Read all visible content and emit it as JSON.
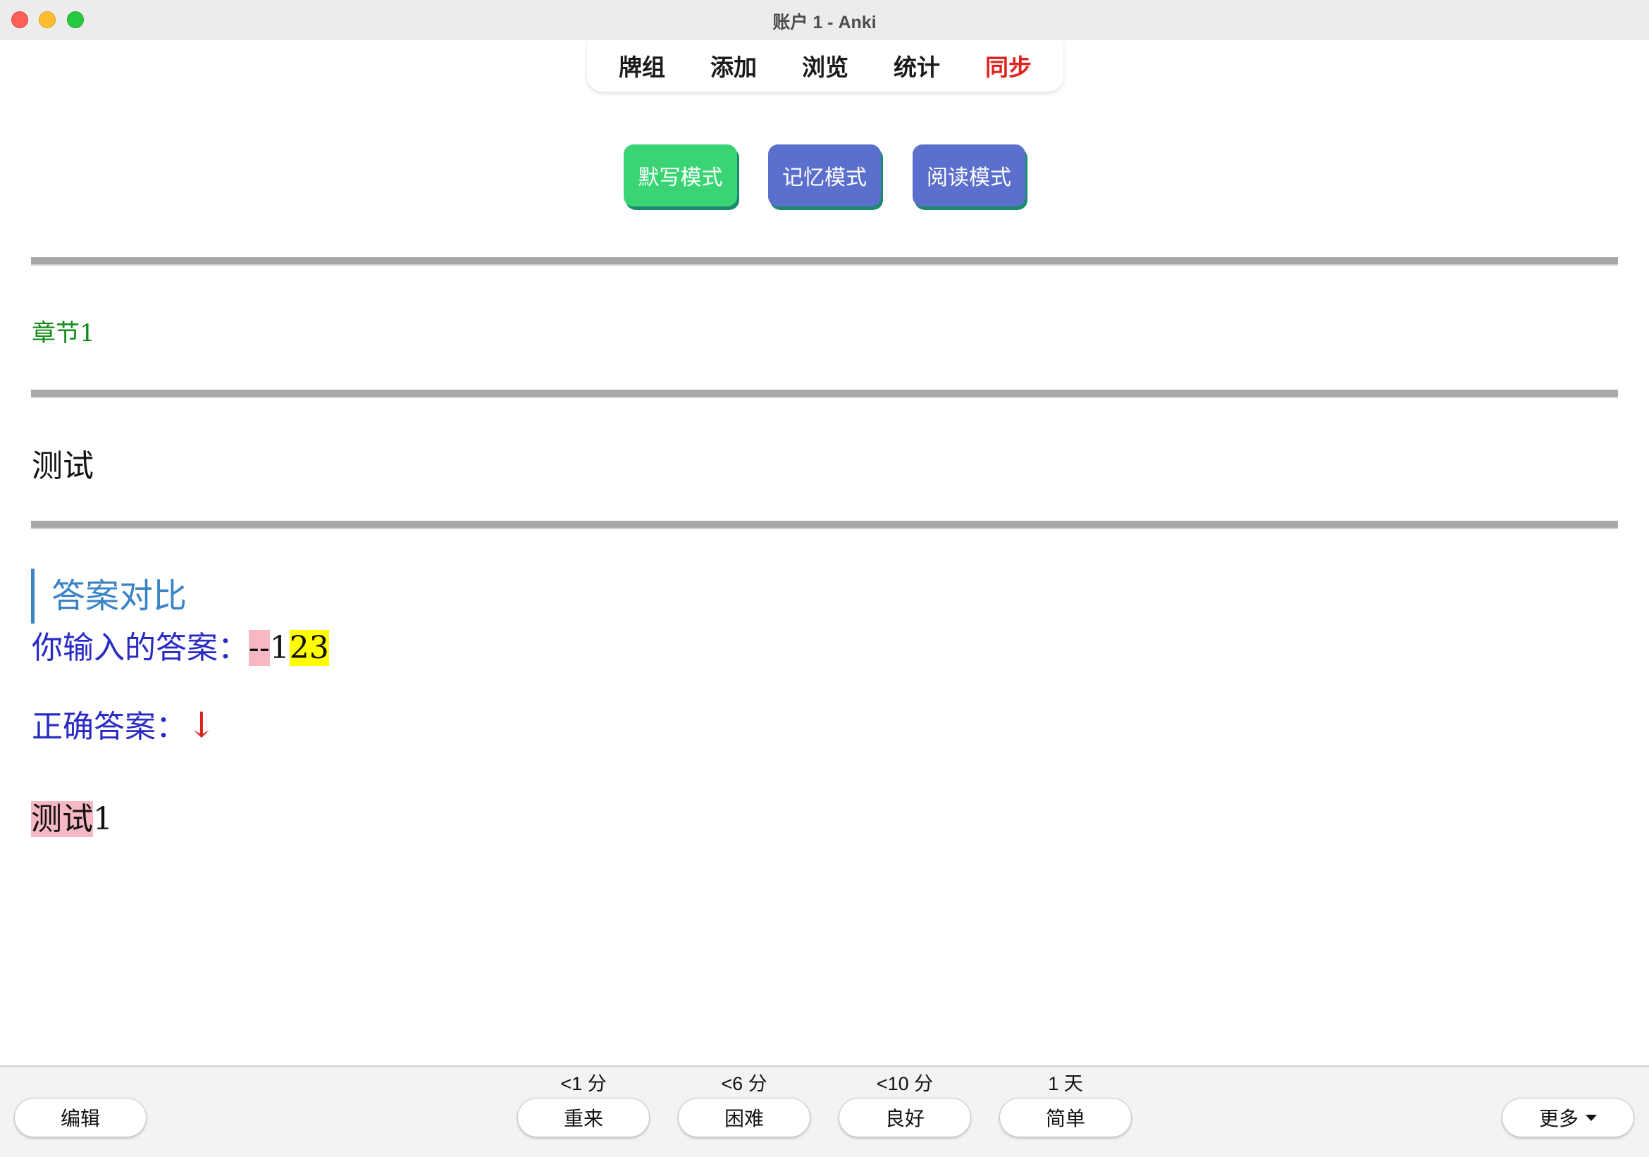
{
  "window": {
    "title": "账户 1 - Anki"
  },
  "nav": {
    "decks": "牌组",
    "add": "添加",
    "browse": "浏览",
    "stats": "统计",
    "sync": "同步"
  },
  "modes": {
    "dictation": "默写模式",
    "memory": "记忆模式",
    "reading": "阅读模式"
  },
  "card": {
    "chapter": "章节1",
    "question": "测试",
    "compare_heading": "答案对比",
    "your_answer_label": "你输入的答案：",
    "your_answer_wrong": "--",
    "your_answer_ok": "1",
    "your_answer_missing": "23",
    "correct_label": "正确答案：",
    "arrow": "↓",
    "correct_bad": "测试",
    "correct_ok": "1"
  },
  "bottom": {
    "edit": "编辑",
    "again": "重来",
    "hard": "困难",
    "good": "良好",
    "easy": "简单",
    "more": "更多",
    "intervals": {
      "again": "<1 分",
      "hard": "<6 分",
      "good": "<10 分",
      "easy": "1 天"
    }
  },
  "colors": {
    "sync": "#e0211b",
    "dictation_button": "#3ad475",
    "mode_button": "#5b6fcc",
    "chapter": "#0f8a14",
    "heading": "#3a84c5",
    "answer_label": "#2a2ac4",
    "wrong_highlight": "#f7b8c3",
    "missing_highlight": "#ffff00"
  }
}
